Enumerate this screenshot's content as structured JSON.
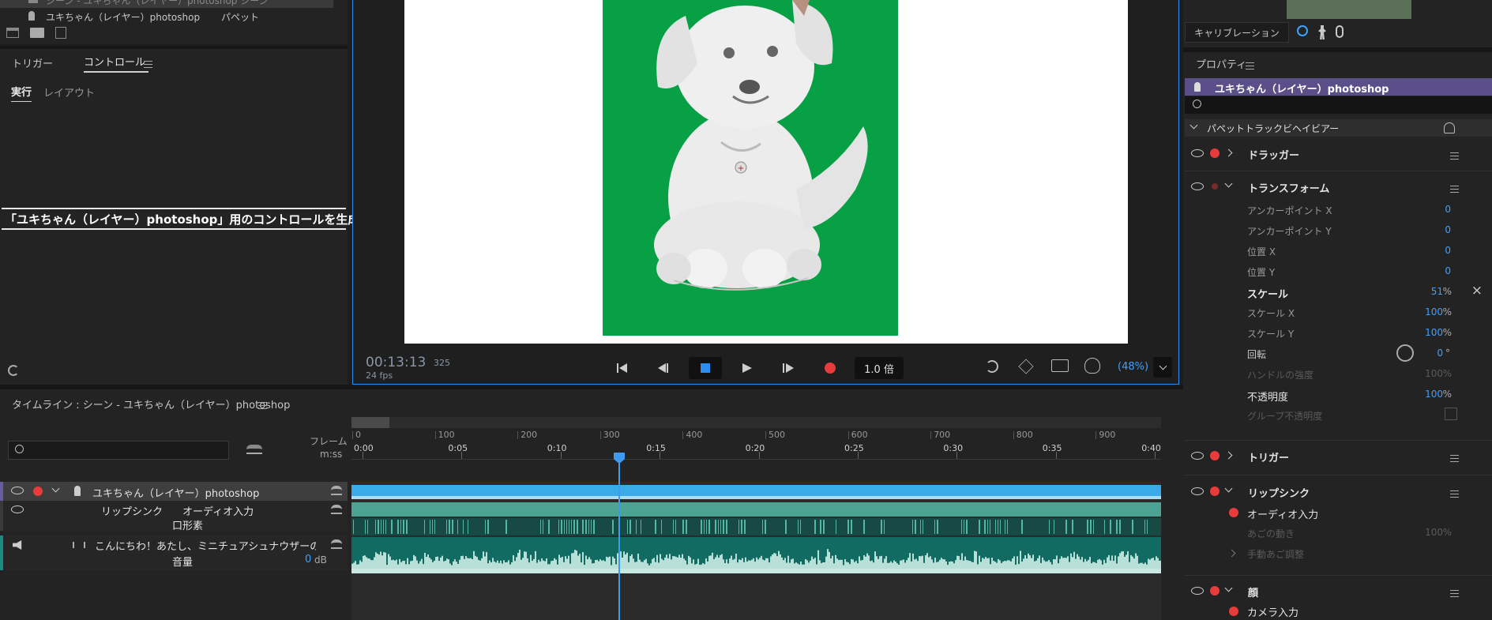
{
  "top_left": {
    "layer_row_cut": "シーン - ユキちゃん（レイヤー）photoshop シーン",
    "layer_name": "ユキちゃん（レイヤー）photoshop",
    "layer_type": "パペット"
  },
  "controls": {
    "tab_trigger": "トリガー",
    "tab_control": "コントロール",
    "subtab_run": "実行",
    "subtab_layout": "レイアウト",
    "generate_label": "「ユキちゃん（レイヤー）photoshop」用のコントロールを生成"
  },
  "monitor": {
    "timecode": "00:13:13",
    "frame": "325",
    "fps": "24 fps",
    "speed": "1.0 倍",
    "zoom": "(48%)"
  },
  "timeline": {
    "title": "タイムライン : シーン - ユキちゃん（レイヤー）photoshop",
    "frame_label": "フレーム",
    "time_label": "m:ss",
    "frame_ticks": [
      "0",
      "100",
      "200",
      "300",
      "400",
      "500",
      "600",
      "700",
      "800",
      "900"
    ],
    "time_ticks": [
      "0:00",
      "0:05",
      "0:10",
      "0:15",
      "0:20",
      "0:25",
      "0:30",
      "0:35",
      "0:40"
    ],
    "tracks": {
      "puppet": "ユキちゃん（レイヤー）photoshop",
      "lipsync": "リップシンク",
      "audio_input": "オーディオ入力",
      "viseme": "口形素",
      "audio_clip": "こんにちわ！あたし、ミニチュアシュナウザーの ...",
      "volume_label": "音量",
      "volume_value": "0",
      "volume_unit": "dB"
    }
  },
  "right": {
    "calibration": "キャリブレーション",
    "properties_title": "プロパティ",
    "puppet_name": "ユキちゃん（レイヤー）photoshop",
    "behavior_section": "パペットトラックビヘイビアー",
    "dragger": "ドラッガー",
    "transform": "トランスフォーム",
    "rows": [
      {
        "label": "アンカーポイント X",
        "value": "0",
        "unit": ""
      },
      {
        "label": "アンカーポイント Y",
        "value": "0",
        "unit": ""
      },
      {
        "label": "位置 X",
        "value": "0",
        "unit": ""
      },
      {
        "label": "位置 Y",
        "value": "0",
        "unit": ""
      },
      {
        "label": "スケール",
        "value": "51",
        "unit": "%"
      },
      {
        "label": "スケール X",
        "value": "100",
        "unit": "%"
      },
      {
        "label": "スケール Y",
        "value": "100",
        "unit": "%"
      },
      {
        "label": "回転",
        "value": "0",
        "unit": "°"
      },
      {
        "label": "ハンドルの強度",
        "value": "100",
        "unit": "%"
      },
      {
        "label": "不透明度",
        "value": "100",
        "unit": "%"
      },
      {
        "label": "グループ不透明度",
        "value": "",
        "unit": ""
      }
    ],
    "trigger": "トリガー",
    "lipsync": "リップシンク",
    "audio_input": "オーディオ入力",
    "jaw_motion": "あごの動き",
    "jaw_value": "100",
    "jaw_unit": "%",
    "manual_jaw": "手動あご調整",
    "face": "顔",
    "camera_input": "カメラ入力"
  }
}
